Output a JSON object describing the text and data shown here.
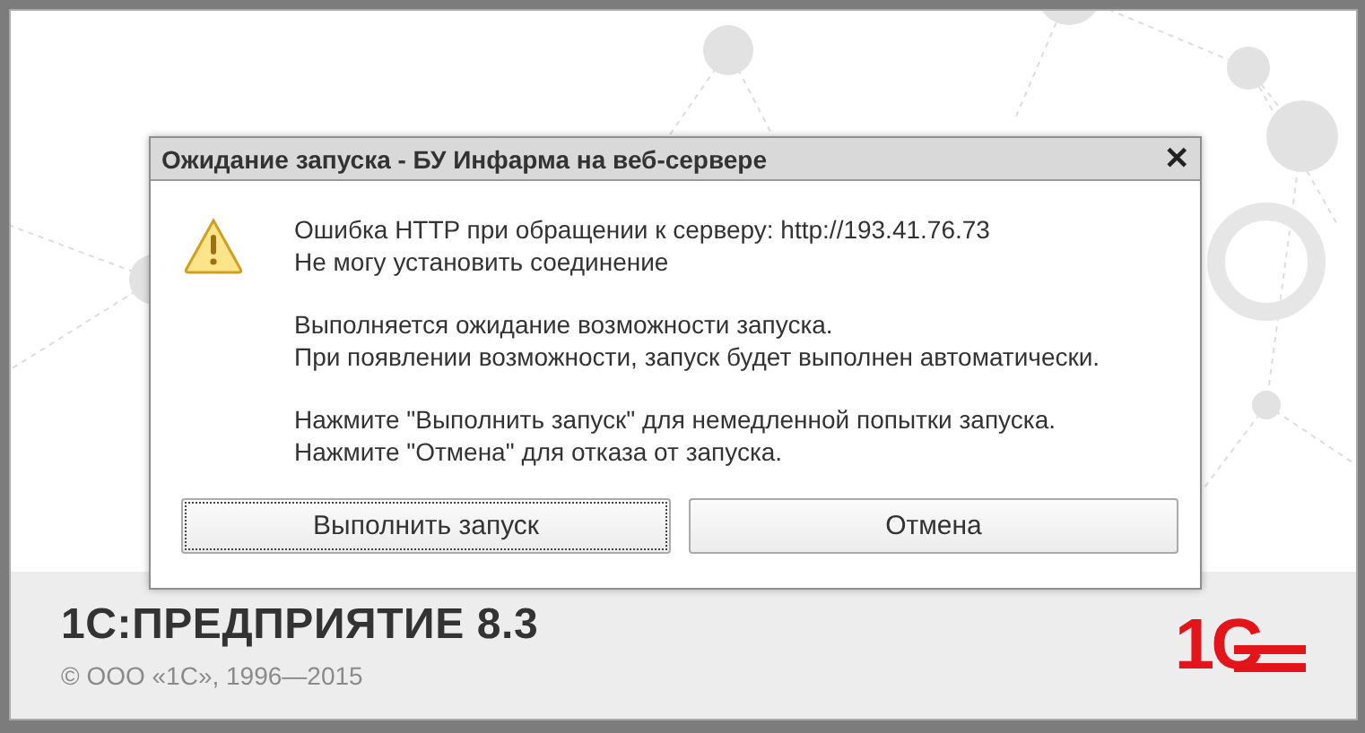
{
  "splash": {
    "product": "1С:ПРЕДПРИЯТИЕ 8.3",
    "copyright": "© ООО «1С», 1996—2015",
    "logo": "1С"
  },
  "dialog": {
    "title": "Ожидание запуска - БУ Инфарма на веб-сервере",
    "close": "✕",
    "paragraphs": [
      [
        "Ошибка HTTP при обращении к серверу: http://193.41.76.73",
        "Не могу установить соединение"
      ],
      [
        "Выполняется ожидание возможности запуска.",
        "При появлении возможности, запуск будет выполнен автоматически."
      ],
      [
        "Нажмите \"Выполнить запуск\" для немедленной попытки запуска.",
        "Нажмите \"Отмена\" для отказа от запуска."
      ]
    ],
    "buttons": [
      {
        "label": "Выполнить запуск",
        "selected": true
      },
      {
        "label": "Отмена",
        "selected": false
      }
    ]
  }
}
